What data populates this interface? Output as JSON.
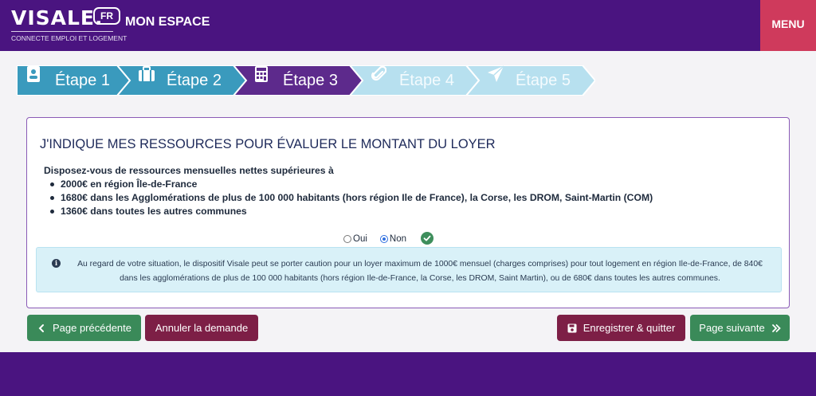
{
  "header": {
    "logo_text": "VISALE.",
    "logo_badge": "FR",
    "logo_tagline": "CONNECTE EMPLOI ET LOGEMENT",
    "space_label": "MON ESPACE",
    "menu_label": "MENU"
  },
  "stepper": {
    "steps": [
      {
        "label": "Étape 1",
        "icon": "id-card-icon",
        "state": "completed"
      },
      {
        "label": "Étape 2",
        "icon": "suitcase-icon",
        "state": "completed"
      },
      {
        "label": "Étape 3",
        "icon": "calculator-icon",
        "state": "current"
      },
      {
        "label": "Étape 4",
        "icon": "paperclip-icon",
        "state": "upcoming"
      },
      {
        "label": "Étape 5",
        "icon": "paper-plane-icon",
        "state": "upcoming"
      }
    ],
    "colors": {
      "completed": "#3a9abd",
      "current": "#5d2a8c",
      "upcoming": "#b7e0ef"
    }
  },
  "form": {
    "title": "J'INDIQUE MES RESSOURCES POUR ÉVALUER LE MONTANT DU LOYER",
    "question": "Disposez-vous de ressources mensuelles nettes supérieures à",
    "bullets": [
      "2000€ en région Île-de-France",
      "1680€ dans les Agglomérations de plus de 100 000 habitants (hors région Ile de France), la Corse, les DROM, Saint-Martin (COM)",
      "1360€ dans toutes les autres communes"
    ],
    "options": {
      "yes": "Oui",
      "no": "Non",
      "selected": "Non"
    },
    "info_line1": "Au regard de votre situation, le dispositif Visale peut se porter caution pour un loyer maximum de 1000€ mensuel (charges comprises) pour tout logement en région Ile-de-France, de 840€",
    "info_line2": "dans les agglomérations de plus de 100 000 habitants (hors région Ile-de-France, la Corse, les DROM, Saint Martin), ou de 680€ dans toutes les autres communes."
  },
  "actions": {
    "prev": "Page précédente",
    "cancel": "Annuler la demande",
    "save": "Enregistrer & quitter",
    "next": "Page suivante"
  },
  "colors": {
    "brand": "#4a1480",
    "menu": "#cf3a5c",
    "green": "#3a8a59",
    "maroon": "#7d1f46"
  }
}
